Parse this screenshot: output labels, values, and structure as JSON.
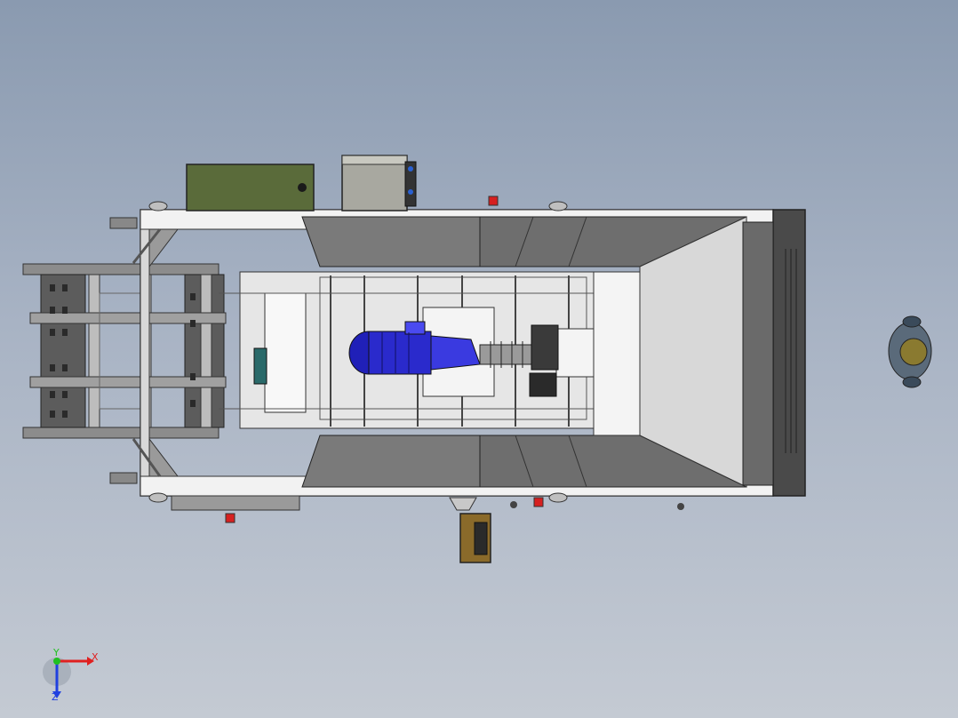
{
  "viewport": {
    "background_top": "#8a9ab0",
    "background_bottom": "#c4cad3"
  },
  "colors": {
    "frame_white": "#f2f2f2",
    "steel_gray": "#6e6e6e",
    "dark_steel": "#4a4a4a",
    "panel_green": "#5a6b3a",
    "motor_blue": "#2a2acc",
    "connector_red": "#d62020",
    "control_box_brown": "#8a6a2a",
    "operator_helmet": "#8a7a30"
  },
  "triad": {
    "x_label": "X",
    "y_label": "Y",
    "z_label": "Z",
    "x_color": "#e02020",
    "y_color": "#20c020",
    "z_color": "#2040e0"
  },
  "components": {
    "control_panel": "green-control-cabinet",
    "drum_motor": "gray-drum-motor",
    "main_motor": "blue-electric-motor",
    "hopper": "feed-hopper",
    "frame": "machine-frame",
    "operator": "operator-figure",
    "control_box": "pendant-control-box"
  }
}
